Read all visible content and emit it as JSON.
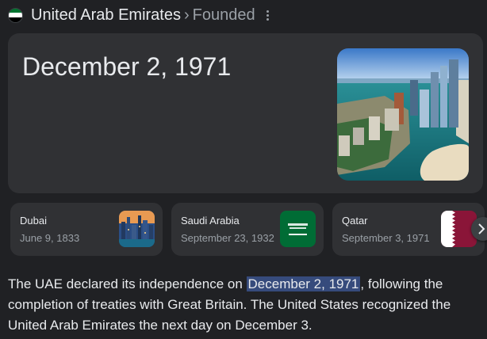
{
  "header": {
    "title": "United Arab Emirates",
    "separator": "›",
    "subtitle": "Founded",
    "flag_icon": "uae-flag-icon",
    "more_icon": "more-vert-icon"
  },
  "answer": {
    "date": "December 2, 1971",
    "image": "abu-dhabi-skyline-photo"
  },
  "related": [
    {
      "name": "Dubai",
      "date": "June 9, 1833",
      "image": "dubai-skyline-photo"
    },
    {
      "name": "Saudi Arabia",
      "date": "September 23, 1932",
      "image": "saudi-arabia-flag"
    },
    {
      "name": "Qatar",
      "date": "September 3, 1971",
      "image": "qatar-flag"
    }
  ],
  "next_icon": "chevron-right-icon",
  "description": {
    "before": "The UAE declared its independence on ",
    "highlight": "December 2, 1971",
    "after": ", following the completion of treaties with Great Britain. The United States recognized the United Arab Emirates the next day on December 3."
  },
  "colors": {
    "background": "#202124",
    "card": "#303134",
    "highlight": "#364b7c",
    "uae_green": "#00732f",
    "uae_red": "#ff0000",
    "saudi_green": "#006c35",
    "qatar_maroon": "#8a1538"
  }
}
